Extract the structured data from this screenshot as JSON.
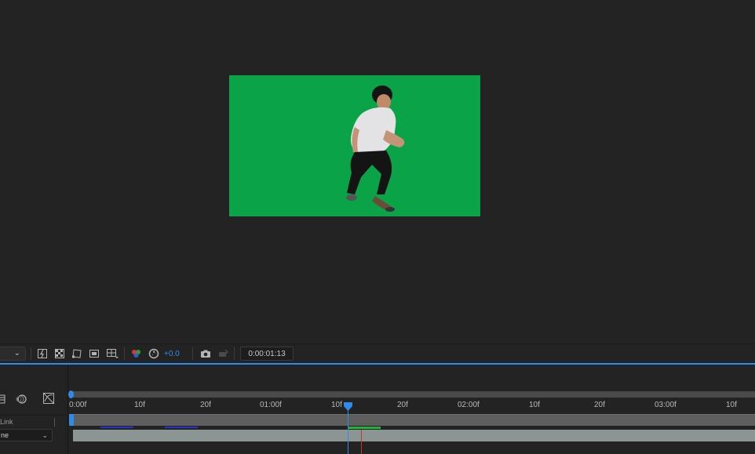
{
  "viewer": {
    "composition_background": "#0aa348",
    "subject": "person-running-on-green-screen"
  },
  "toolbar": {
    "magnification_value": "",
    "exposure_value": "+0.0",
    "current_time": "0:00:01:13",
    "accent_color": "#2d8ceb"
  },
  "timeline": {
    "ruler_labels": [
      "0:00f",
      "10f",
      "20f",
      "01:00f",
      "10f",
      "20f",
      "02:00f",
      "10f",
      "20f",
      "03:00f",
      "10f"
    ],
    "layer_link_label": "Link",
    "mode_value": "ne",
    "playhead_color": "#2d8ceb",
    "marker_color": "#d0302a"
  }
}
